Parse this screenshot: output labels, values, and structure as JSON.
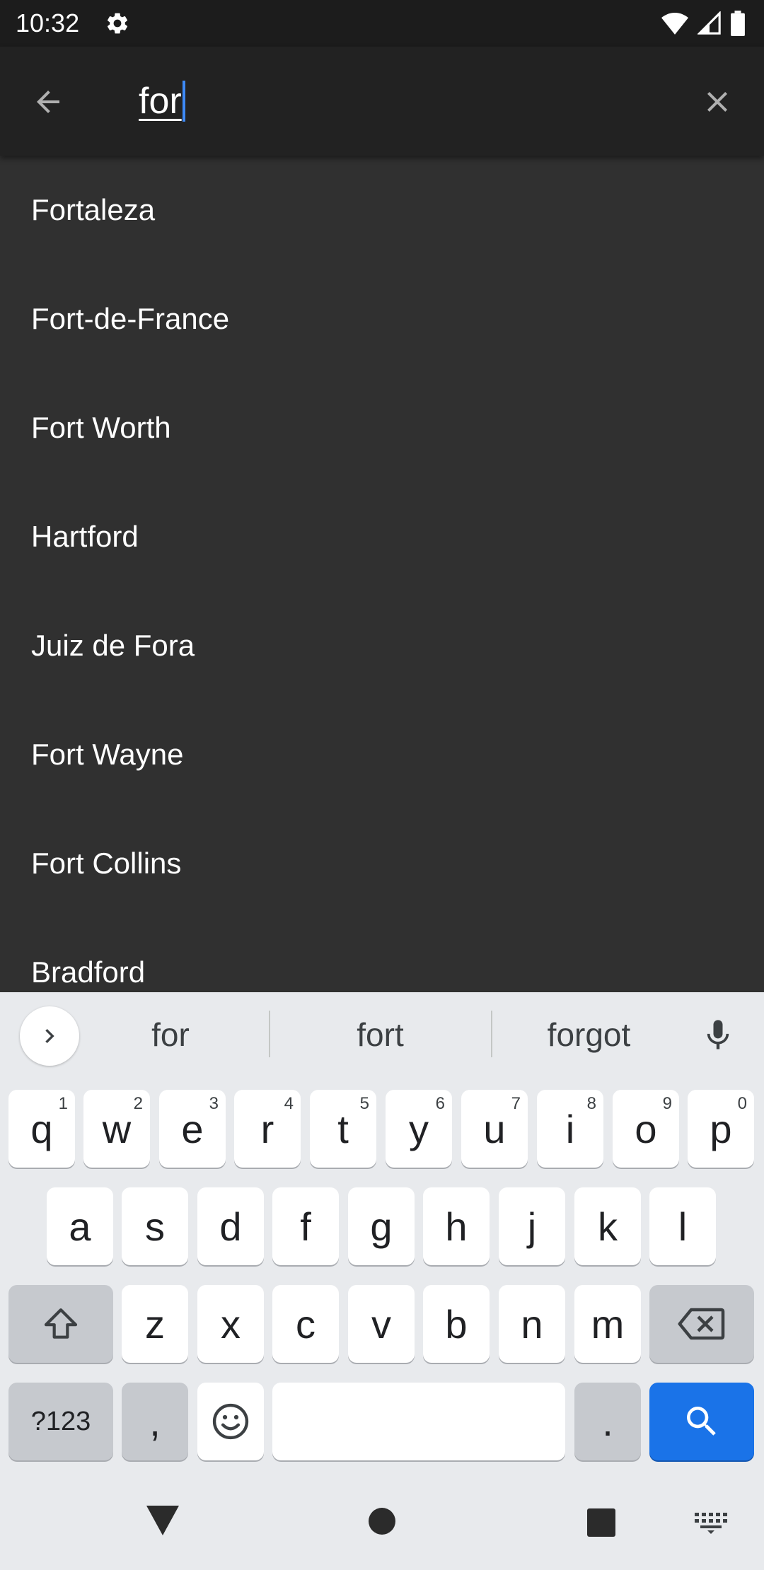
{
  "status_bar": {
    "time": "10:32",
    "icons": [
      "settings-gear-icon",
      "wifi-icon",
      "cellular-signal-icon",
      "battery-icon"
    ]
  },
  "search": {
    "query": "for",
    "back_icon": "arrow-back-icon",
    "clear_icon": "close-icon",
    "caret_color": "#3d8af7"
  },
  "results": [
    "Fortaleza",
    "Fort-de-France",
    "Fort Worth",
    "Hartford",
    "Juiz de Fora",
    "Fort Wayne",
    "Fort Collins",
    "Bradford"
  ],
  "keyboard": {
    "suggestions": [
      "for",
      "fort",
      "forgot"
    ],
    "row1": [
      {
        "key": "q",
        "hint": "1"
      },
      {
        "key": "w",
        "hint": "2"
      },
      {
        "key": "e",
        "hint": "3"
      },
      {
        "key": "r",
        "hint": "4"
      },
      {
        "key": "t",
        "hint": "5"
      },
      {
        "key": "y",
        "hint": "6"
      },
      {
        "key": "u",
        "hint": "7"
      },
      {
        "key": "i",
        "hint": "8"
      },
      {
        "key": "o",
        "hint": "9"
      },
      {
        "key": "p",
        "hint": "0"
      }
    ],
    "row2": [
      "a",
      "s",
      "d",
      "f",
      "g",
      "h",
      "j",
      "k",
      "l"
    ],
    "row3": [
      "z",
      "x",
      "c",
      "v",
      "b",
      "n",
      "m"
    ],
    "symbols_label": "?123",
    "comma_label": ",",
    "period_label": ".",
    "action_color": "#1a73e8"
  },
  "nav_bar": {
    "icons": [
      "nav-back-icon",
      "nav-home-icon",
      "nav-recents-icon",
      "keyboard-switch-icon"
    ]
  }
}
